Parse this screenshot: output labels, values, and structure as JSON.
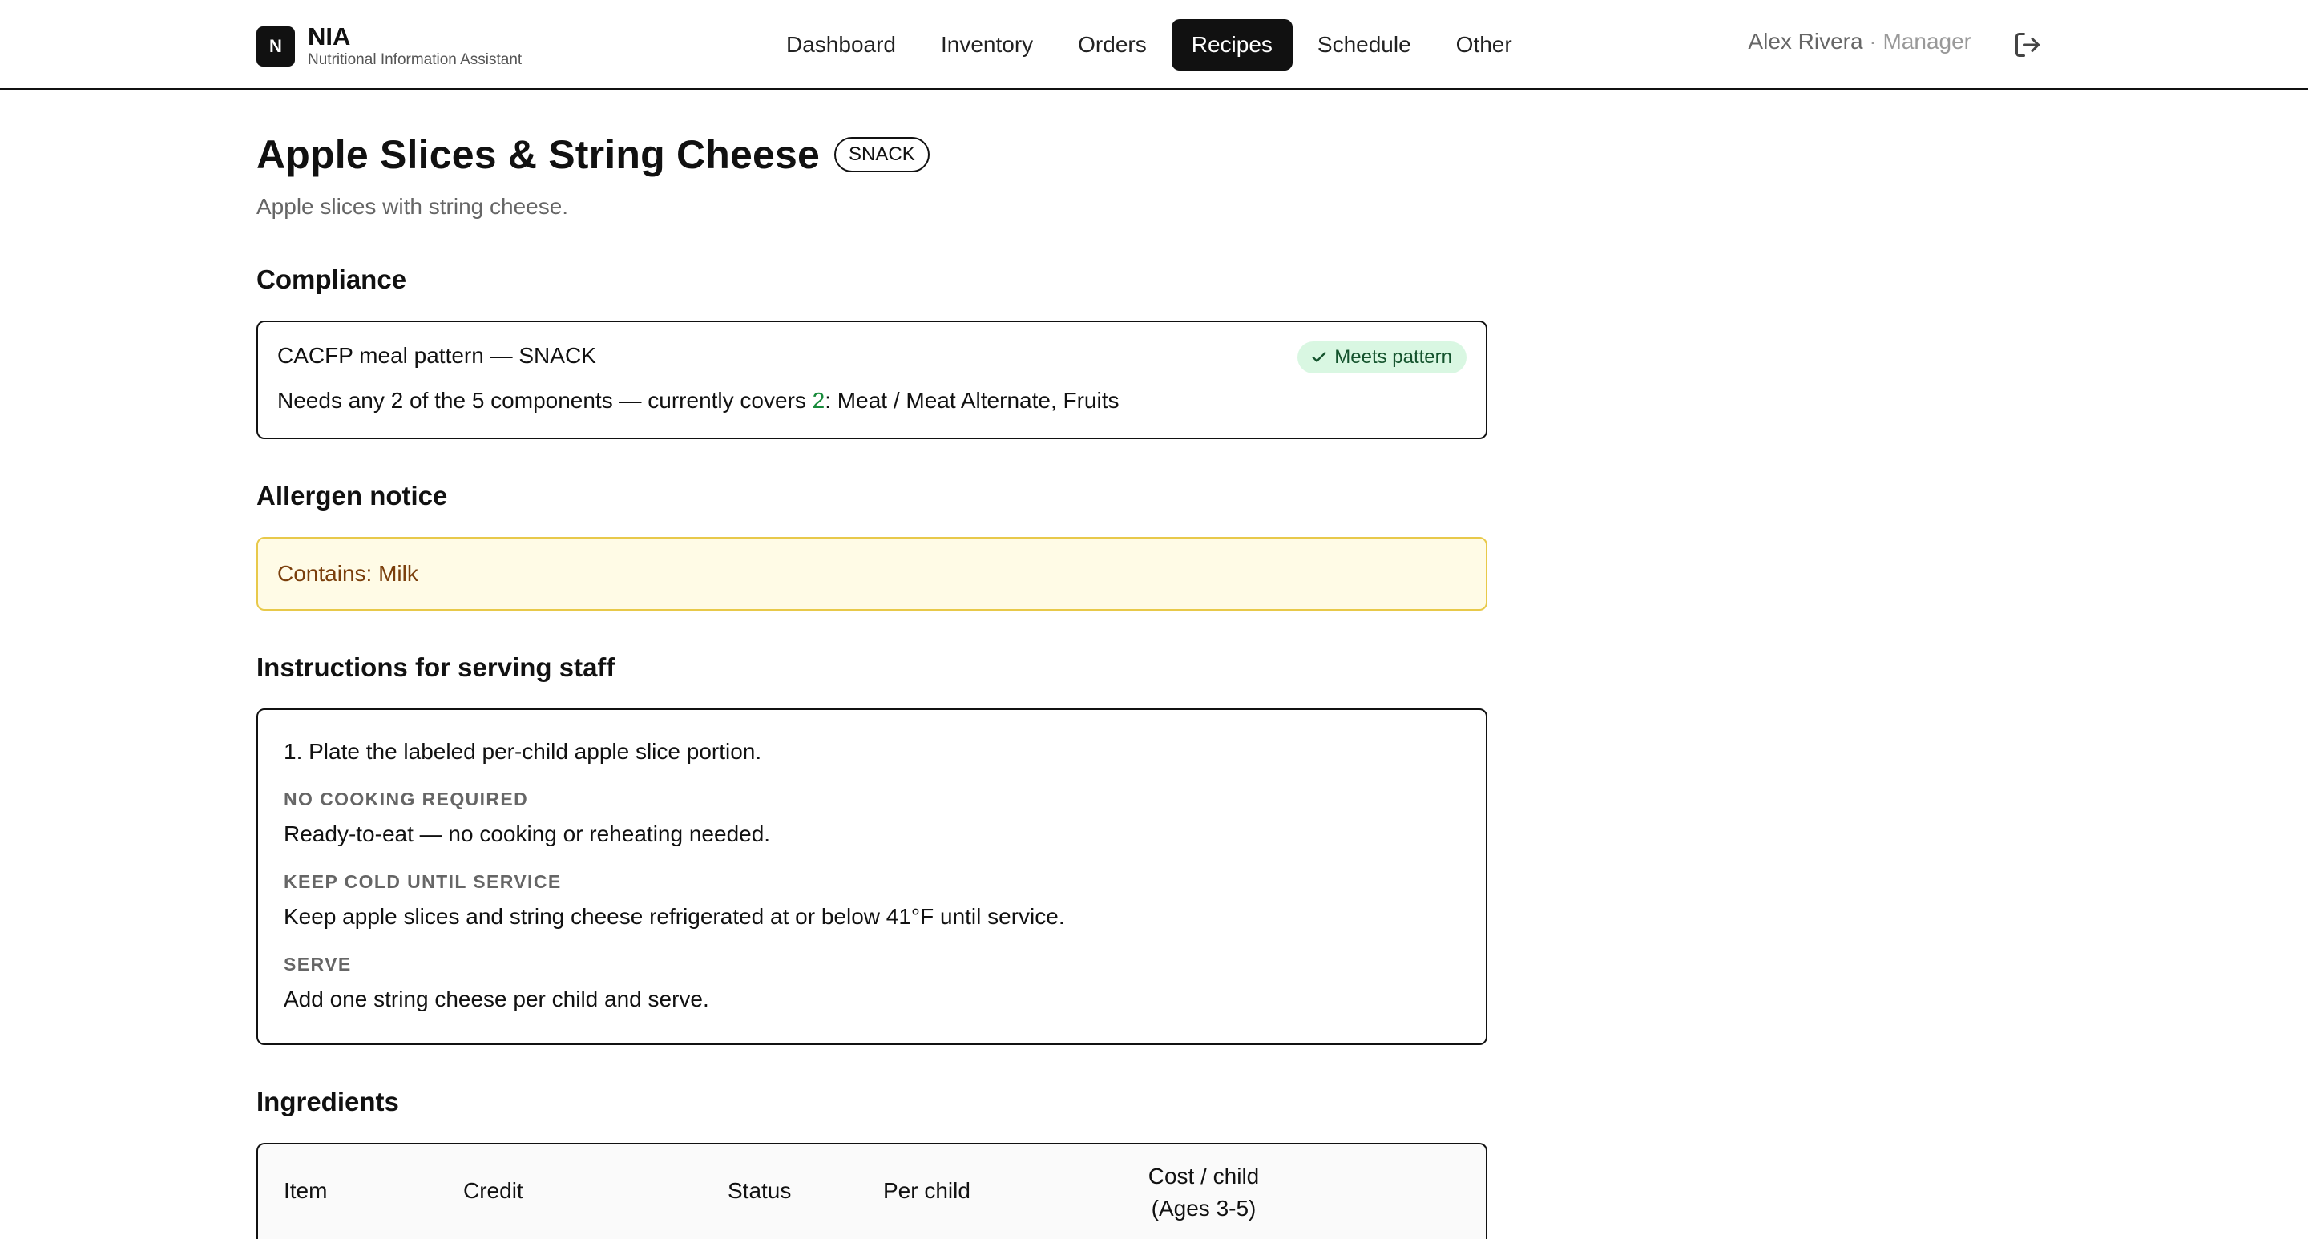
{
  "app": {
    "logo_letter": "N",
    "name": "NIA",
    "subtitle": "Nutritional Information Assistant"
  },
  "nav": {
    "items": [
      {
        "label": "Dashboard",
        "active": false
      },
      {
        "label": "Inventory",
        "active": false
      },
      {
        "label": "Orders",
        "active": false
      },
      {
        "label": "Recipes",
        "active": true
      },
      {
        "label": "Schedule",
        "active": false
      },
      {
        "label": "Other",
        "active": false
      }
    ]
  },
  "user": {
    "name": "Alex Rivera",
    "separator": "·",
    "role": "Manager",
    "logout_icon": "logout-icon"
  },
  "recipe": {
    "title": "Apple Slices & String Cheese",
    "meal_type_badge": "SNACK",
    "description": "Apple slices with string cheese."
  },
  "compliance": {
    "heading": "Compliance",
    "pattern_line": "CACFP meal pattern — SNACK",
    "status_label": "Meets pattern",
    "status_icon": "check-icon",
    "status_color": "#178a3a",
    "needs_prefix": "Needs any 2 of the 5 components — currently covers ",
    "covered_count": "2",
    "covered_suffix": ": Meat / Meat Alternate, Fruits"
  },
  "allergen": {
    "heading": "Allergen notice",
    "text": "Contains: Milk"
  },
  "instructions": {
    "heading": "Instructions for serving staff",
    "step_1": "1. Plate the labeled per-child apple slice portion.",
    "sections": [
      {
        "label": "NO COOKING REQUIRED",
        "text": "Ready-to-eat — no cooking or reheating needed."
      },
      {
        "label": "KEEP COLD UNTIL SERVICE",
        "text": "Keep apple slices and string cheese refrigerated at or below 41°F until service."
      },
      {
        "label": "SERVE",
        "text": "Add one string cheese per child and serve."
      }
    ]
  },
  "ingredients": {
    "heading": "Ingredients",
    "columns": {
      "item": "Item",
      "credit": "Credit",
      "status": "Status",
      "per_child": "Per child",
      "cost_line1": "Cost / child",
      "cost_line2": "(Ages 3-5)"
    }
  }
}
